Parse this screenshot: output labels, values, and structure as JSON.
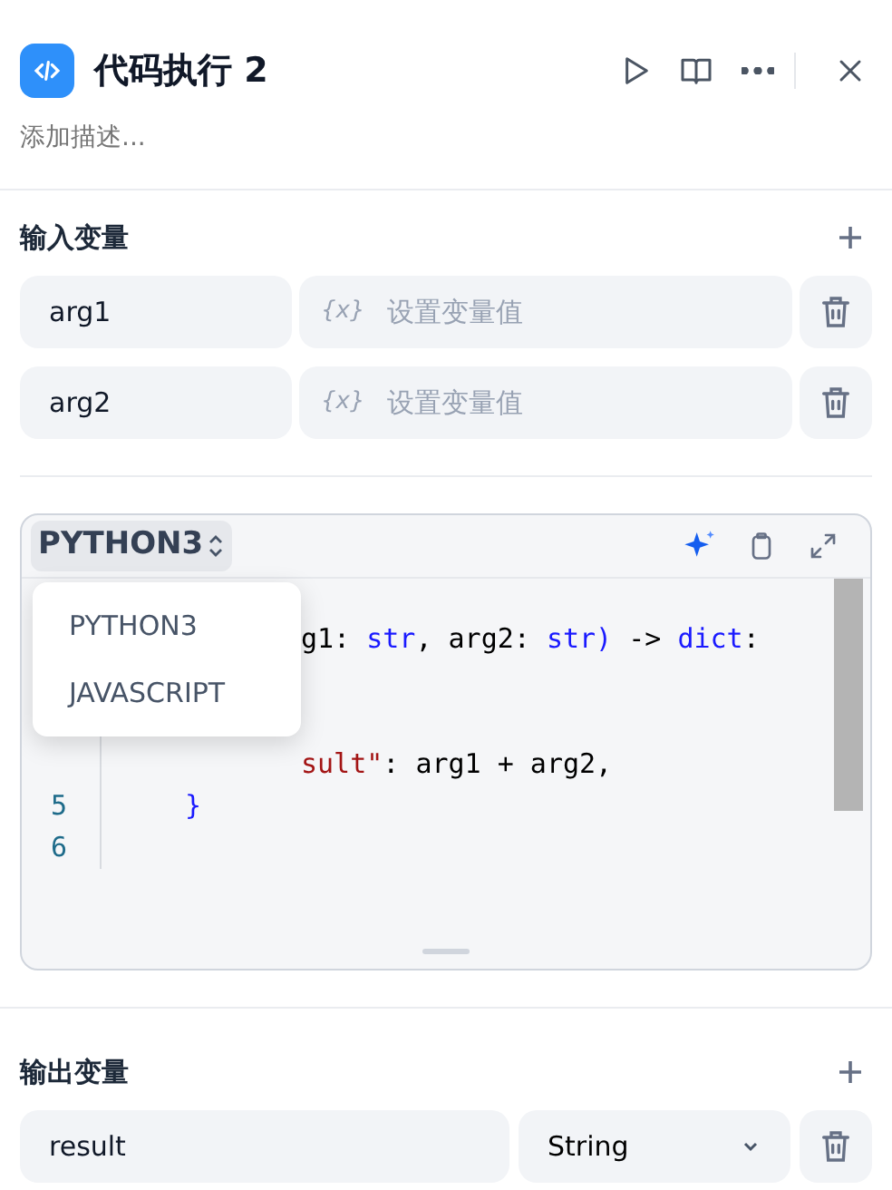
{
  "header": {
    "title": "代码执行 2",
    "description_placeholder": "添加描述..."
  },
  "input_section": {
    "title": "输入变量",
    "variables": [
      {
        "name": "arg1",
        "value_placeholder": "设置变量值",
        "value_icon": "{x}"
      },
      {
        "name": "arg2",
        "value_placeholder": "设置变量值",
        "value_icon": "{x}"
      }
    ]
  },
  "code_editor": {
    "language": "PYTHON3",
    "language_menu": {
      "open": true,
      "options": [
        {
          "label": "PYTHON3"
        },
        {
          "label": "JAVASCRIPT"
        }
      ]
    },
    "lines": [
      {
        "kind": "clipped",
        "tokens": [
          {
            "text": "g1: ",
            "color": "#000000"
          },
          {
            "text": "str",
            "color": "#1a1aff"
          },
          {
            "text": ", arg2: ",
            "color": "#000000"
          },
          {
            "text": "str)",
            "color": "#1a1aff"
          },
          {
            "text": " -> ",
            "color": "#000000"
          },
          {
            "text": "dict",
            "color": "#1a1aff"
          },
          {
            "text": ":",
            "color": "#000000"
          }
        ]
      },
      {
        "kind": "clipped"
      },
      {
        "kind": "clipped"
      },
      {
        "kind": "clipped",
        "tokens": [
          {
            "text": "sult\"",
            "color": "#a31515"
          },
          {
            "text": ": arg1 + arg2,",
            "color": "#000000"
          }
        ]
      },
      {
        "number": "5",
        "kind": "indented",
        "tokens": [
          {
            "text": "}",
            "color": "#1a1aff"
          }
        ]
      },
      {
        "number": "6",
        "kind": "normal"
      }
    ]
  },
  "output_section": {
    "title": "输出变量",
    "variables": [
      {
        "name": "result",
        "type": "String"
      }
    ]
  }
}
